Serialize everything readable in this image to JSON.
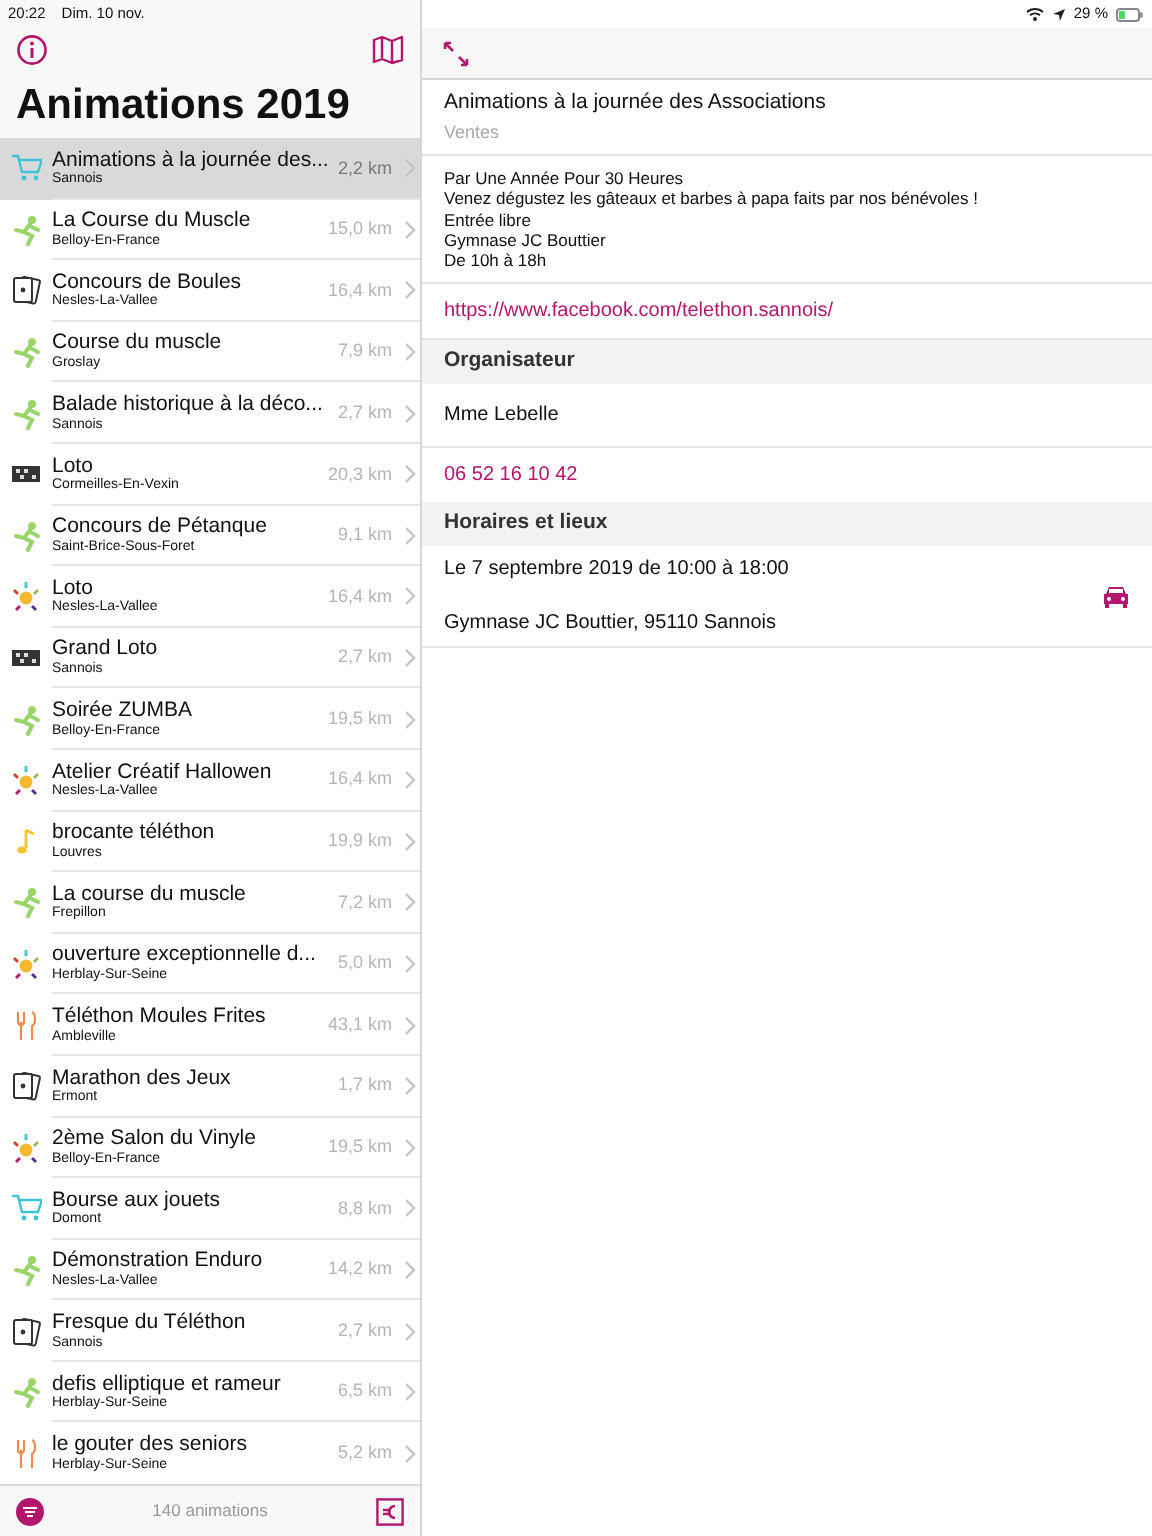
{
  "status_bar": {
    "time": "20:22",
    "date": "Dim. 10 nov.",
    "battery": "29 %"
  },
  "sidebar": {
    "title": "Animations 2019",
    "items": [
      {
        "kind": "cart",
        "title": "Animations à la journée des...",
        "town": "Sannois",
        "distance": "2,2 km",
        "selected": true
      },
      {
        "kind": "runner",
        "title": "La Course du Muscle",
        "town": "Belloy-En-France",
        "distance": "15,0 km",
        "selected": false
      },
      {
        "kind": "cards",
        "title": "Concours de Boules",
        "town": "Nesles-La-Vallee",
        "distance": "16,4 km",
        "selected": false
      },
      {
        "kind": "runner",
        "title": "Course du muscle",
        "town": "Groslay",
        "distance": "7,9 km",
        "selected": false
      },
      {
        "kind": "runner",
        "title": "Balade historique à la déco...",
        "town": "Sannois",
        "distance": "2,7 km",
        "selected": false
      },
      {
        "kind": "board",
        "title": "Loto",
        "town": "Cormeilles-En-Vexin",
        "distance": "20,3 km",
        "selected": false
      },
      {
        "kind": "runner",
        "title": "Concours de Pétanque",
        "town": "Saint-Brice-Sous-Foret",
        "distance": "9,1 km",
        "selected": false
      },
      {
        "kind": "sun",
        "title": "Loto",
        "town": "Nesles-La-Vallee",
        "distance": "16,4 km",
        "selected": false
      },
      {
        "kind": "board",
        "title": "Grand Loto",
        "town": "Sannois",
        "distance": "2,7 km",
        "selected": false
      },
      {
        "kind": "runner",
        "title": "Soirée ZUMBA",
        "town": "Belloy-En-France",
        "distance": "19,5 km",
        "selected": false
      },
      {
        "kind": "sun",
        "title": "Atelier Créatif Hallowen",
        "town": "Nesles-La-Vallee",
        "distance": "16,4 km",
        "selected": false
      },
      {
        "kind": "note",
        "title": "brocante téléthon",
        "town": "Louvres",
        "distance": "19,9 km",
        "selected": false
      },
      {
        "kind": "runner",
        "title": "La course du muscle",
        "town": "Frepillon",
        "distance": "7,2 km",
        "selected": false
      },
      {
        "kind": "sun",
        "title": "ouverture exceptionnelle d...",
        "town": "Herblay-Sur-Seine",
        "distance": "5,0 km",
        "selected": false
      },
      {
        "kind": "cutlery",
        "title": "Téléthon Moules Frites",
        "town": "Ambleville",
        "distance": "43,1 km",
        "selected": false
      },
      {
        "kind": "cards",
        "title": "Marathon des Jeux",
        "town": "Ermont",
        "distance": "1,7 km",
        "selected": false
      },
      {
        "kind": "sun",
        "title": "2ème Salon du Vinyle",
        "town": "Belloy-En-France",
        "distance": "19,5 km",
        "selected": false
      },
      {
        "kind": "cart",
        "title": "Bourse aux jouets",
        "town": "Domont",
        "distance": "8,8 km",
        "selected": false
      },
      {
        "kind": "runner",
        "title": "Démonstration Enduro",
        "town": "Nesles-La-Vallee",
        "distance": "14,2 km",
        "selected": false
      },
      {
        "kind": "cards",
        "title": "Fresque du Téléthon",
        "town": "Sannois",
        "distance": "2,7 km",
        "selected": false
      },
      {
        "kind": "runner",
        "title": "defis elliptique et rameur",
        "town": "Herblay-Sur-Seine",
        "distance": "6,5 km",
        "selected": false
      },
      {
        "kind": "cutlery",
        "title": "le gouter des seniors",
        "town": "Herblay-Sur-Seine",
        "distance": "5,2 km",
        "selected": false
      }
    ],
    "count": "140 animations"
  },
  "detail": {
    "title": "Animations à la journée des Associations",
    "category": "Ventes",
    "description": [
      "Par Une Année Pour 30 Heures",
      "Venez dégustez les gâteaux et barbes à papa faits par nos bénévoles !",
      "Entrée libre",
      "Gymnase JC Bouttier",
      "De 10h à 18h"
    ],
    "link": "https://www.facebook.com/telethon.sannois/",
    "organizer": {
      "heading": "Organisateur",
      "name": "Mme Lebelle",
      "phone": "06 52 16 10 42"
    },
    "schedule": {
      "heading": "Horaires et lieux",
      "when": "Le 7 septembre 2019 de 10:00 à 18:00",
      "where": "Gymnase JC Bouttier, 95110 Sannois"
    }
  }
}
